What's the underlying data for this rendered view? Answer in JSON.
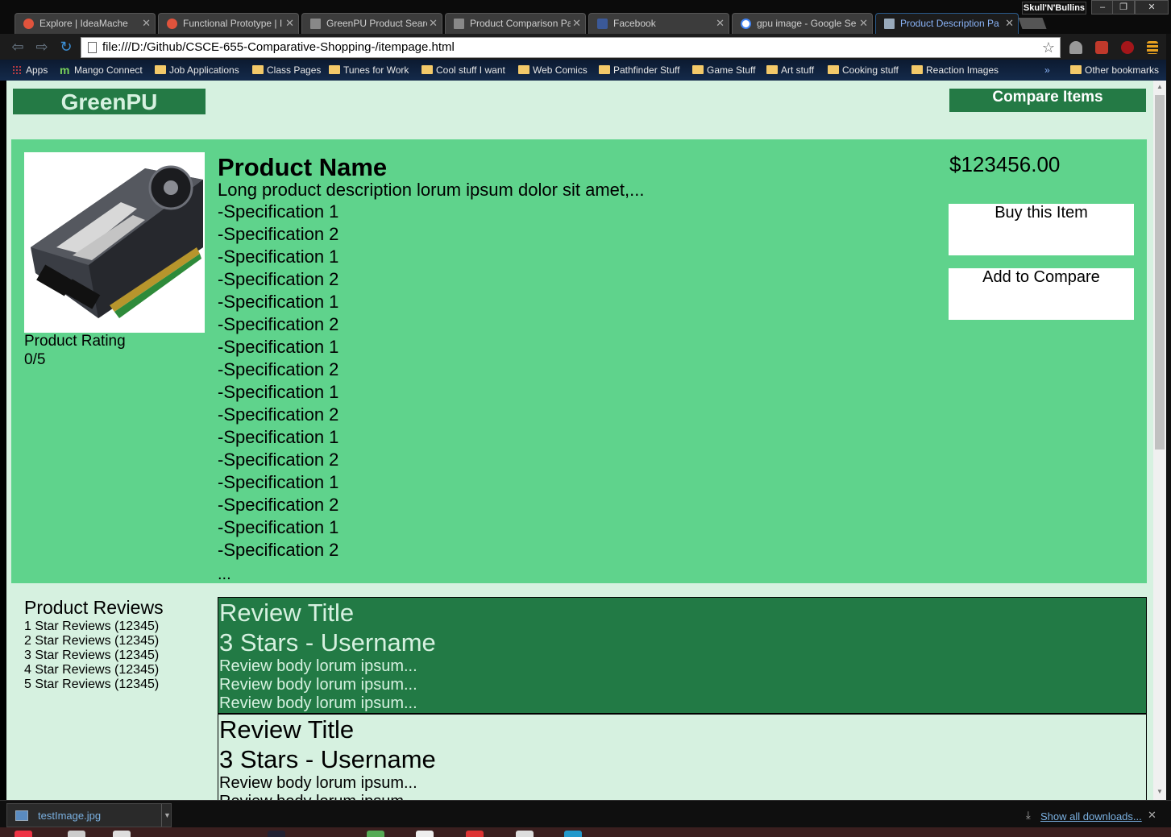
{
  "browser": {
    "profile_name": "Skull'N'Bullins",
    "tabs": [
      {
        "label": "Explore | IdeaMache",
        "active": false
      },
      {
        "label": "Functional Prototype | I",
        "active": false
      },
      {
        "label": "GreenPU Product Searc",
        "active": false
      },
      {
        "label": "Product Comparison Pa",
        "active": false
      },
      {
        "label": "Facebook",
        "active": false
      },
      {
        "label": "gpu image - Google Se",
        "active": false
      },
      {
        "label": "Product Description Pa",
        "active": true
      }
    ],
    "url": "file:///D:/Github/CSCE-655-Comparative-Shopping-/itempage.html",
    "bookmarks": [
      {
        "label": "Apps",
        "icon": "apps-icon"
      },
      {
        "label": "Mango Connect",
        "icon": "mango-icon"
      },
      {
        "label": "Job Applications",
        "icon": "folder-icon"
      },
      {
        "label": "Class Pages",
        "icon": "folder-icon"
      },
      {
        "label": "Tunes for Work",
        "icon": "folder-icon"
      },
      {
        "label": "Cool stuff I want",
        "icon": "folder-icon"
      },
      {
        "label": "Web Comics",
        "icon": "folder-icon"
      },
      {
        "label": "Pathfinder Stuff",
        "icon": "folder-icon"
      },
      {
        "label": "Game Stuff",
        "icon": "folder-icon"
      },
      {
        "label": "Art stuff",
        "icon": "folder-icon"
      },
      {
        "label": "Cooking stuff",
        "icon": "folder-icon"
      },
      {
        "label": "Reaction Images",
        "icon": "folder-icon"
      }
    ],
    "bookmarks_overflow": "»",
    "other_bookmarks": "Other bookmarks"
  },
  "page": {
    "logo": "GreenPU",
    "compare_items": "Compare Items",
    "product": {
      "name": "Product Name",
      "description": "Long product description lorum ipsum dolor sit amet,...",
      "specs": [
        "-Specification 1",
        "-Specification 2",
        "-Specification 1",
        "-Specification 2",
        "-Specification 1",
        "-Specification 2",
        "-Specification 1",
        "-Specification 2",
        "-Specification 1",
        "-Specification 2",
        "-Specification 1",
        "-Specification 2",
        "-Specification 1",
        "-Specification 2",
        "-Specification 1",
        "-Specification 2"
      ],
      "specs_more": "...",
      "rating_label": "Product Rating",
      "rating_value": "0/5",
      "price": "$123456.00",
      "buy_label": "Buy this Item",
      "compare_label": "Add to Compare"
    },
    "reviews_summary": {
      "title": "Product Reviews",
      "lines": [
        "1 Star Reviews (12345)",
        "2 Star Reviews (12345)",
        "3 Star Reviews (12345)",
        "4 Star Reviews (12345)",
        "5 Star Reviews (12345)"
      ]
    },
    "reviews": [
      {
        "title": "Review Title",
        "rating": "3 Stars - Username",
        "body": [
          "Review body lorum ipsum...",
          "Review body lorum ipsum...",
          "Review body lorum ipsum..."
        ]
      },
      {
        "title": "Review Title",
        "rating": "3 Stars - Username",
        "body": [
          "Review body lorum ipsum...",
          "Review body lorum ipsum..."
        ]
      }
    ]
  },
  "downloads": {
    "file_name": "testImage.jpg",
    "show_all": "Show all downloads..."
  },
  "colors": {
    "page_bg": "#d6f1e0",
    "panel_green": "#5fd38c",
    "dark_green": "#247a45"
  }
}
